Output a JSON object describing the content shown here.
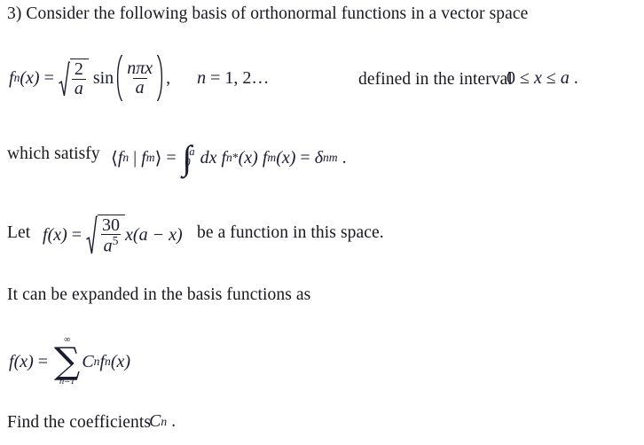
{
  "document": {
    "type": "physics-homework-problem",
    "problem_number": "3)",
    "background_color": "#ffffff",
    "text_color": "#17171f",
    "math_color": "#1b1b30"
  },
  "lines": {
    "intro": "3) Consider the following basis of orthonormal functions in a vector space",
    "which_satisfy": "which satisfy",
    "let": "Let",
    "be_a_function": "be a function in this space.",
    "expanded": "It can be expanded in the basis functions as",
    "find": "Find the coefficients",
    "defined_interval": "defined in the interval",
    "period": "."
  },
  "eq_basis": {
    "lhs_f": "f",
    "lhs_sub_n": "n",
    "lhs_arg": "(x)",
    "equals": "=",
    "radicand_num": "2",
    "radicand_den": "a",
    "sin": "sin",
    "arg_num": "nπx",
    "arg_den": "a",
    "comma": ",",
    "n_index": "n",
    "n_equals": "=",
    "n_values": "1, 2…"
  },
  "eq_interval": {
    "zero": "0",
    "le1": "≤",
    "x": "x",
    "le2": "≤",
    "a": "a",
    "period": "."
  },
  "eq_orthonormal": {
    "bra_open": "⟨",
    "f1": "f",
    "f1_sub": "n",
    "bar": "|",
    "f2": "f",
    "f2_sub": "m",
    "ket_close": "⟩",
    "equals": "=",
    "integral": "∫",
    "limit_upper": "a",
    "limit_lower": "0",
    "dx": "dx",
    "fn_star": "f",
    "fn_star_sub": "n",
    "fn_star_sup": "*",
    "fn_star_arg": "(x)",
    "fm": "f",
    "fm_sub": "m",
    "fm_arg": "(x)",
    "equals2": "=",
    "delta": "δ",
    "delta_sub": "nm",
    "period": "."
  },
  "eq_f": {
    "f": "f",
    "arg": "(x)",
    "equals": "=",
    "radicand_num": "30",
    "radicand_den_base": "a",
    "radicand_den_exp": "5",
    "tail": "x(a − x)"
  },
  "eq_expansion": {
    "f": "f",
    "arg": "(x)",
    "equals": "=",
    "sum_symbol": "∑",
    "sum_upper": "∞",
    "sum_lower": "n=1",
    "coeff": "C",
    "coeff_sub": "n",
    "basis": "f",
    "basis_sub": "n",
    "basis_arg": "(x)"
  },
  "eq_find": {
    "coeff": "C",
    "coeff_sub": "n",
    "period": "."
  }
}
